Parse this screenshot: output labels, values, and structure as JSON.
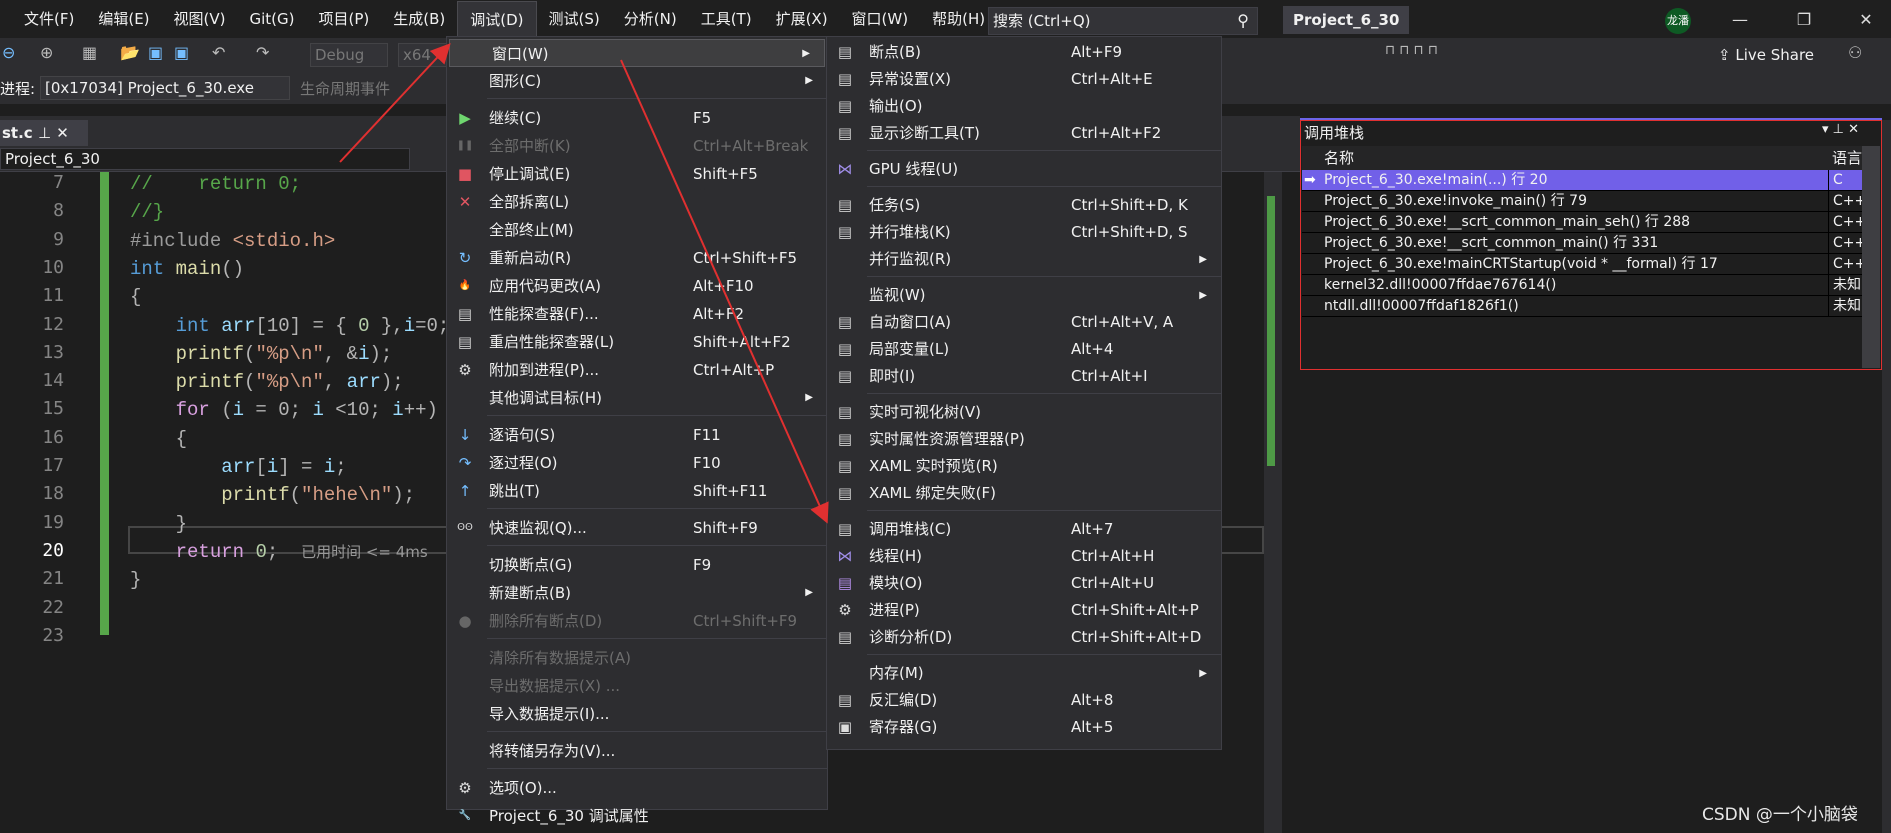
{
  "menubar": {
    "items": [
      "文件(F)",
      "编辑(E)",
      "视图(V)",
      "Git(G)",
      "项目(P)",
      "生成(B)",
      "调试(D)",
      "测试(S)",
      "分析(N)",
      "工具(T)",
      "扩展(X)",
      "窗口(W)",
      "帮助(H)"
    ],
    "active": "调试(D)"
  },
  "search": {
    "placeholder": "搜索 (Ctrl+Q)",
    "icon": "search-icon"
  },
  "project_title": "Project_6_30",
  "avatar": "龙潘",
  "toolbar": {
    "config": "Debug",
    "platform": "x64",
    "live_share": "Live Share",
    "process_label": "进程:",
    "process": "[0x17034] Project_6_30.exe",
    "lifecycle": "生命周期事件"
  },
  "editor": {
    "tab": "st.c",
    "nav": "Project_6_30",
    "lines": [
      {
        "n": "7",
        "t": [
          [
            "//    return 0;",
            "cm"
          ]
        ]
      },
      {
        "n": "8",
        "t": [
          [
            "//}",
            "cm"
          ]
        ]
      },
      {
        "n": "9",
        "t": [
          [
            "#include ",
            "pp"
          ],
          [
            "<stdio.h>",
            "str"
          ]
        ]
      },
      {
        "n": "10",
        "t": [
          [
            "int ",
            "kw"
          ],
          [
            "main",
            "fn"
          ],
          [
            "()",
            "pn"
          ]
        ]
      },
      {
        "n": "11",
        "t": [
          [
            "{",
            "pn"
          ]
        ]
      },
      {
        "n": "12",
        "t": [
          [
            "    ",
            "pn"
          ],
          [
            "int ",
            "kw"
          ],
          [
            "arr",
            "var"
          ],
          [
            "[10] = { ",
            "pn"
          ],
          [
            "0",
            "num"
          ],
          [
            " },",
            "pn"
          ],
          [
            "i",
            "var"
          ],
          [
            "=0;",
            "pn"
          ]
        ]
      },
      {
        "n": "13",
        "t": [
          [
            "    ",
            "pn"
          ],
          [
            "printf",
            "fn"
          ],
          [
            "(",
            "pn"
          ],
          [
            "\"%p\\n\"",
            "str"
          ],
          [
            ", &",
            "pn"
          ],
          [
            "i",
            "var"
          ],
          [
            ");",
            "pn"
          ]
        ]
      },
      {
        "n": "14",
        "t": [
          [
            "    ",
            "pn"
          ],
          [
            "printf",
            "fn"
          ],
          [
            "(",
            "pn"
          ],
          [
            "\"%p\\n\"",
            "str"
          ],
          [
            ", ",
            "pn"
          ],
          [
            "arr",
            "var"
          ],
          [
            ");",
            "pn"
          ]
        ]
      },
      {
        "n": "15",
        "t": [
          [
            "    ",
            "pn"
          ],
          [
            "for ",
            "ret"
          ],
          [
            "(",
            "pn"
          ],
          [
            "i",
            "var"
          ],
          [
            " = 0; ",
            "pn"
          ],
          [
            "i",
            "var"
          ],
          [
            " <10; ",
            "pn"
          ],
          [
            "i",
            "var"
          ],
          [
            "++)",
            "pn"
          ]
        ]
      },
      {
        "n": "16",
        "t": [
          [
            "    {",
            "pn"
          ]
        ]
      },
      {
        "n": "17",
        "t": [
          [
            "        ",
            "pn"
          ],
          [
            "arr",
            "var"
          ],
          [
            "[",
            "pn"
          ],
          [
            "i",
            "var"
          ],
          [
            "] = ",
            "pn"
          ],
          [
            "i",
            "var"
          ],
          [
            ";",
            "pn"
          ]
        ]
      },
      {
        "n": "18",
        "t": [
          [
            "        ",
            "pn"
          ],
          [
            "printf",
            "fn"
          ],
          [
            "(",
            "pn"
          ],
          [
            "\"hehe\\n\"",
            "str"
          ],
          [
            ");",
            "pn"
          ]
        ]
      },
      {
        "n": "19",
        "t": [
          [
            "    }",
            "pn"
          ]
        ]
      },
      {
        "n": "20",
        "t": [
          [
            "    ",
            "pn"
          ],
          [
            "return ",
            "ret"
          ],
          [
            "0",
            "num"
          ],
          [
            ";  ",
            "pn"
          ],
          [
            "已用时间 <= 4ms",
            "hint"
          ]
        ]
      },
      {
        "n": "21",
        "t": [
          [
            "}",
            "pn"
          ]
        ]
      },
      {
        "n": "22",
        "t": []
      },
      {
        "n": "23",
        "t": []
      }
    ],
    "current_line": "20"
  },
  "debug_menu": [
    {
      "label": "窗口(W)",
      "sub": true,
      "hl": true
    },
    {
      "label": "图形(C)",
      "sub": true
    },
    {
      "sep": true
    },
    {
      "label": "继续(C)",
      "sc": "F5",
      "icon": "play-icon"
    },
    {
      "label": "全部中断(K)",
      "sc": "Ctrl+Alt+Break",
      "dis": true,
      "icon": "pause-icon"
    },
    {
      "label": "停止调试(E)",
      "sc": "Shift+F5",
      "icon": "stop-icon"
    },
    {
      "label": "全部拆离(L)",
      "icon": "detach-icon"
    },
    {
      "label": "全部终止(M)"
    },
    {
      "label": "重新启动(R)",
      "sc": "Ctrl+Shift+F5",
      "icon": "restart-icon"
    },
    {
      "label": "应用代码更改(A)",
      "sc": "Alt+F10",
      "icon": "hot-reload-icon"
    },
    {
      "label": "性能探查器(F)...",
      "sc": "Alt+F2",
      "icon": "profiler-icon"
    },
    {
      "label": "重启性能探查器(L)",
      "sc": "Shift+Alt+F2",
      "icon": "profiler-restart-icon"
    },
    {
      "label": "附加到进程(P)...",
      "sc": "Ctrl+Alt+P",
      "icon": "attach-icon"
    },
    {
      "label": "其他调试目标(H)",
      "sub": true
    },
    {
      "sep": true
    },
    {
      "label": "逐语句(S)",
      "sc": "F11",
      "icon": "step-into-icon"
    },
    {
      "label": "逐过程(O)",
      "sc": "F10",
      "icon": "step-over-icon"
    },
    {
      "label": "跳出(T)",
      "sc": "Shift+F11",
      "icon": "step-out-icon"
    },
    {
      "sep": true
    },
    {
      "label": "快速监视(Q)...",
      "sc": "Shift+F9",
      "icon": "glasses-icon"
    },
    {
      "sep": true
    },
    {
      "label": "切换断点(G)",
      "sc": "F9"
    },
    {
      "label": "新建断点(B)",
      "sub": true
    },
    {
      "label": "删除所有断点(D)",
      "sc": "Ctrl+Shift+F9",
      "dis": true,
      "icon": "delete-breakpoints-icon"
    },
    {
      "sep": true
    },
    {
      "label": "清除所有数据提示(A)",
      "dis": true
    },
    {
      "label": "导出数据提示(X) ...",
      "dis": true
    },
    {
      "label": "导入数据提示(I)..."
    },
    {
      "sep": true
    },
    {
      "label": "将转储另存为(V)..."
    },
    {
      "sep": true
    },
    {
      "label": "选项(O)...",
      "icon": "gear-icon"
    },
    {
      "label": "Project_6_30 调试属性",
      "icon": "wrench-icon"
    }
  ],
  "window_submenu": [
    {
      "label": "断点(B)",
      "sc": "Alt+F9",
      "icon": "breakpoints-icon"
    },
    {
      "label": "异常设置(X)",
      "sc": "Ctrl+Alt+E",
      "icon": "exception-icon"
    },
    {
      "label": "输出(O)",
      "icon": "output-icon"
    },
    {
      "label": "显示诊断工具(T)",
      "sc": "Ctrl+Alt+F2",
      "icon": "diagnostics-icon"
    },
    {
      "sep": true
    },
    {
      "label": "GPU 线程(U)",
      "icon": "gpu-thread-icon"
    },
    {
      "sep": true
    },
    {
      "label": "任务(S)",
      "sc": "Ctrl+Shift+D, K",
      "icon": "tasks-icon"
    },
    {
      "label": "并行堆栈(K)",
      "sc": "Ctrl+Shift+D, S",
      "icon": "parallel-stacks-icon"
    },
    {
      "label": "并行监视(R)",
      "sub": true
    },
    {
      "sep": true
    },
    {
      "label": "监视(W)",
      "sub": true
    },
    {
      "label": "自动窗口(A)",
      "sc": "Ctrl+Alt+V, A",
      "icon": "autos-icon"
    },
    {
      "label": "局部变量(L)",
      "sc": "Alt+4",
      "icon": "locals-icon"
    },
    {
      "label": "即时(I)",
      "sc": "Ctrl+Alt+I",
      "icon": "immediate-icon"
    },
    {
      "sep": true
    },
    {
      "label": "实时可视化树(V)",
      "icon": "visual-tree-icon"
    },
    {
      "label": "实时属性资源管理器(P)",
      "icon": "property-explorer-icon"
    },
    {
      "label": "XAML 实时预览(R)",
      "icon": "xaml-preview-icon"
    },
    {
      "label": "XAML 绑定失败(F)",
      "icon": "xaml-binding-icon"
    },
    {
      "sep": true
    },
    {
      "label": "调用堆栈(C)",
      "sc": "Alt+7",
      "icon": "call-stack-icon"
    },
    {
      "label": "线程(H)",
      "sc": "Ctrl+Alt+H",
      "icon": "threads-icon"
    },
    {
      "label": "模块(O)",
      "sc": "Ctrl+Alt+U",
      "icon": "modules-icon"
    },
    {
      "label": "进程(P)",
      "sc": "Ctrl+Shift+Alt+P",
      "icon": "processes-icon"
    },
    {
      "label": "诊断分析(D)",
      "sc": "Ctrl+Shift+Alt+D",
      "icon": "diagnostic-analysis-icon"
    },
    {
      "sep": true
    },
    {
      "label": "内存(M)",
      "sub": true
    },
    {
      "label": "反汇编(D)",
      "sc": "Alt+8",
      "icon": "disassembly-icon"
    },
    {
      "label": "寄存器(G)",
      "sc": "Alt+5",
      "icon": "registers-icon"
    }
  ],
  "call_stack": {
    "title": "调用堆栈",
    "col_name": "名称",
    "col_lang": "语言",
    "rows": [
      {
        "name": "Project_6_30.exe!main(...) 行 20",
        "lang": "C",
        "current": true
      },
      {
        "name": "Project_6_30.exe!invoke_main() 行 79",
        "lang": "C++"
      },
      {
        "name": "Project_6_30.exe!__scrt_common_main_seh() 行 288",
        "lang": "C++"
      },
      {
        "name": "Project_6_30.exe!__scrt_common_main() 行 331",
        "lang": "C++"
      },
      {
        "name": "Project_6_30.exe!mainCRTStartup(void * __formal) 行 17",
        "lang": "C++"
      },
      {
        "name": "kernel32.dll!00007ffdae767614()",
        "lang": "未知"
      },
      {
        "name": "ntdll.dll!00007ffdaf1826f1()",
        "lang": "未知"
      }
    ]
  },
  "watermark": "CSDN @一个小脑袋",
  "colors": {
    "accent": "#7160e8",
    "annotation": "#e03030",
    "breakpoint_bar": "#57a64a"
  }
}
